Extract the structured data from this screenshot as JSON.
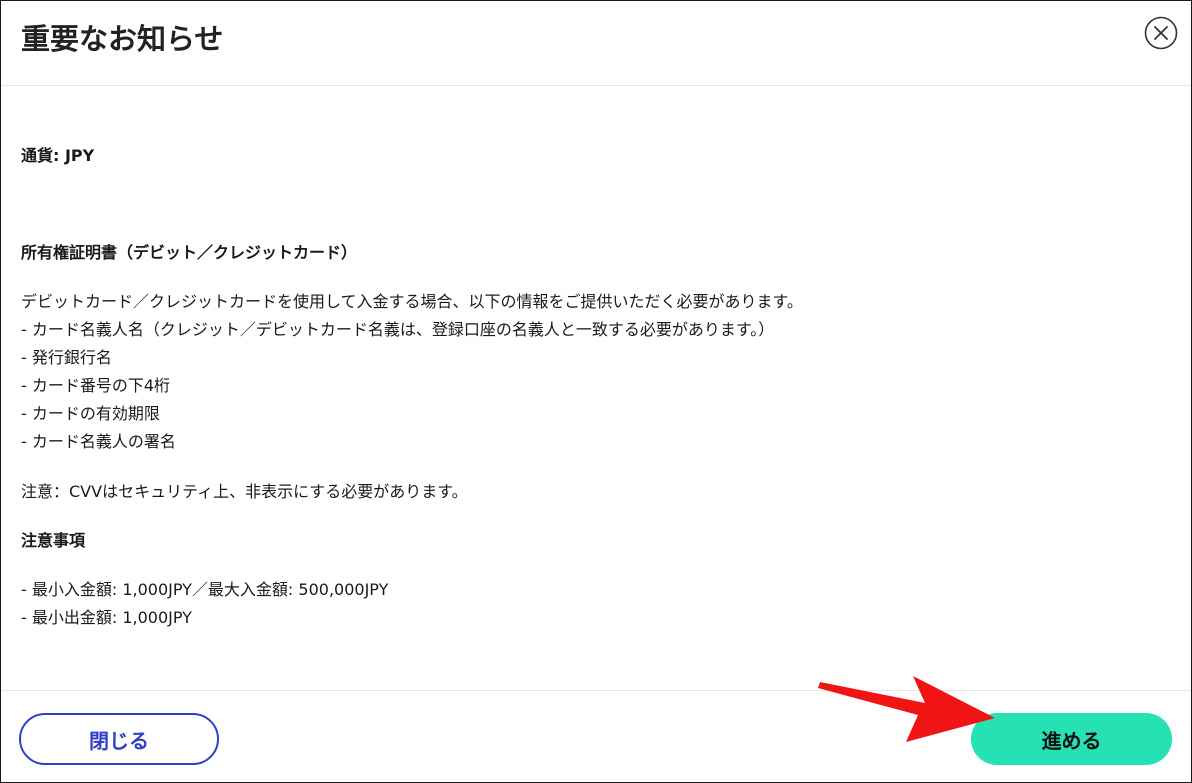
{
  "dialog": {
    "title": "重要なお知らせ"
  },
  "body": {
    "currency_line": "通貨: JPY",
    "proof_heading": "所有権証明書（デビット／クレジットカード）",
    "proof_lines": [
      "デビットカード／クレジットカードを使用して入金する場合、以下の情報をご提供いただく必要があります。",
      "- カード名義人名（クレジット／デビットカード名義は、登録口座の名義人と一致する必要があります。）",
      "- 発行銀行名",
      "- カード番号の下4桁",
      "- カードの有効期限",
      "- カード名義人の署名"
    ],
    "cvv_note": "注意：CVVはセキュリティ上、非表示にする必要があります。",
    "notes_heading": "注意事項",
    "limit_lines": [
      "- 最小入金額: 1,000JPY／最大入金額: 500,000JPY",
      "- 最小出金額: 1,000JPY"
    ]
  },
  "footer": {
    "close_label": "閉じる",
    "proceed_label": "進める"
  },
  "colors": {
    "close_button": "#2f3fc9",
    "proceed_button": "#26e1b4",
    "annotation_arrow": "#f01414"
  },
  "icons": {
    "close": "close-circle-icon",
    "annotation": "red-arrow-icon"
  }
}
